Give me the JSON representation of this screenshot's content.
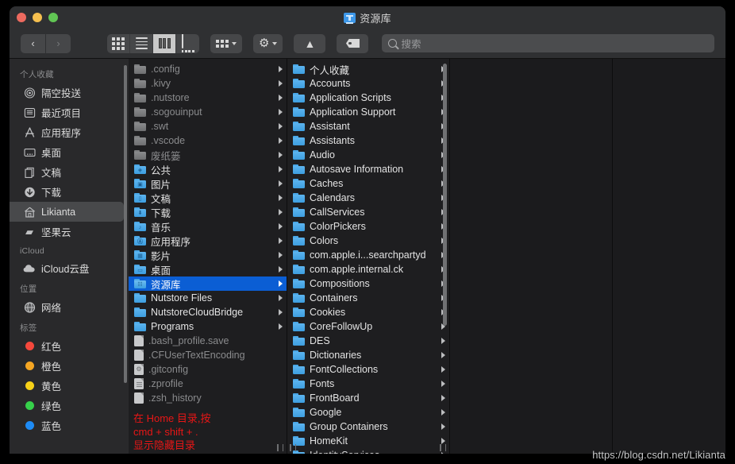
{
  "window": {
    "title": "资源库",
    "title_icon": "library-folder-icon",
    "traffic_lights": [
      {
        "name": "close",
        "color": "#ed6a5f"
      },
      {
        "name": "minimize",
        "color": "#f5bf4f"
      },
      {
        "name": "maximize",
        "color": "#61c554"
      }
    ]
  },
  "toolbar": {
    "back_label": "‹",
    "forward_label": "›",
    "view_modes": [
      {
        "name": "icon-view",
        "selected": false
      },
      {
        "name": "list-view",
        "selected": false
      },
      {
        "name": "column-view",
        "selected": true
      },
      {
        "name": "gallery-view",
        "selected": false
      }
    ],
    "group_button": "group-by-button",
    "action_button": "action-gear-button",
    "share_button": "share-button",
    "tags_button": "tags-button",
    "search": {
      "placeholder": "搜索",
      "value": ""
    }
  },
  "sidebar": {
    "sections": [
      {
        "header": "个人收藏",
        "items": [
          {
            "label": "隔空投送",
            "icon": "airdrop-icon",
            "selected": false
          },
          {
            "label": "最近项目",
            "icon": "recents-icon",
            "selected": false
          },
          {
            "label": "应用程序",
            "icon": "applications-icon",
            "selected": false
          },
          {
            "label": "桌面",
            "icon": "desktop-icon",
            "selected": false
          },
          {
            "label": "文稿",
            "icon": "documents-icon",
            "selected": false
          },
          {
            "label": "下载",
            "icon": "downloads-icon",
            "selected": false
          },
          {
            "label": "Likianta",
            "icon": "home-icon",
            "selected": true
          },
          {
            "label": "坚果云",
            "icon": "folder-icon",
            "selected": false
          }
        ]
      },
      {
        "header": "iCloud",
        "items": [
          {
            "label": "iCloud云盘",
            "icon": "icloud-icon",
            "selected": false
          }
        ]
      },
      {
        "header": "位置",
        "items": [
          {
            "label": "网络",
            "icon": "network-globe-icon",
            "selected": false
          }
        ]
      },
      {
        "header": "标签",
        "items": [
          {
            "label": "红色",
            "icon": "tag-dot-icon",
            "color": "#f5483c",
            "selected": false
          },
          {
            "label": "橙色",
            "icon": "tag-dot-icon",
            "color": "#f5a623",
            "selected": false
          },
          {
            "label": "黄色",
            "icon": "tag-dot-icon",
            "color": "#f7d118",
            "selected": false
          },
          {
            "label": "绿色",
            "icon": "tag-dot-icon",
            "color": "#36d04a",
            "selected": false
          },
          {
            "label": "蓝色",
            "icon": "tag-dot-icon",
            "color": "#1e8bf5",
            "selected": false
          }
        ]
      }
    ]
  },
  "columns": [
    {
      "name": "home-column",
      "items": [
        {
          "label": ".config",
          "icon": "folder-gray",
          "dim": true,
          "arrow": true,
          "selected": false
        },
        {
          "label": ".kivy",
          "icon": "folder-gray",
          "dim": true,
          "arrow": true,
          "selected": false
        },
        {
          "label": ".nutstore",
          "icon": "folder-gray",
          "dim": true,
          "arrow": true,
          "selected": false
        },
        {
          "label": ".sogouinput",
          "icon": "folder-gray",
          "dim": true,
          "arrow": true,
          "selected": false
        },
        {
          "label": ".swt",
          "icon": "folder-gray",
          "dim": true,
          "arrow": true,
          "selected": false
        },
        {
          "label": ".vscode",
          "icon": "folder-gray",
          "dim": true,
          "arrow": true,
          "selected": false
        },
        {
          "label": "废纸篓",
          "icon": "folder-gray",
          "dim": true,
          "arrow": true,
          "selected": false
        },
        {
          "label": "公共",
          "icon": "folder-public",
          "dim": false,
          "arrow": true,
          "selected": false
        },
        {
          "label": "图片",
          "icon": "folder-pictures",
          "dim": false,
          "arrow": true,
          "selected": false
        },
        {
          "label": "文稿",
          "icon": "folder-documents",
          "dim": false,
          "arrow": true,
          "selected": false
        },
        {
          "label": "下载",
          "icon": "folder-downloads",
          "dim": false,
          "arrow": true,
          "selected": false
        },
        {
          "label": "音乐",
          "icon": "folder-music",
          "dim": false,
          "arrow": true,
          "selected": false
        },
        {
          "label": "应用程序",
          "icon": "folder-applications",
          "dim": false,
          "arrow": true,
          "selected": false
        },
        {
          "label": "影片",
          "icon": "folder-movies",
          "dim": false,
          "arrow": true,
          "selected": false
        },
        {
          "label": "桌面",
          "icon": "folder-desktop",
          "dim": false,
          "arrow": true,
          "selected": false
        },
        {
          "label": "资源库",
          "icon": "folder-library",
          "dim": false,
          "arrow": true,
          "selected": true
        },
        {
          "label": "Nutstore Files",
          "icon": "folder-blue",
          "dim": false,
          "arrow": true,
          "selected": false
        },
        {
          "label": "NutstoreCloudBridge",
          "icon": "folder-blue",
          "dim": false,
          "arrow": true,
          "selected": false
        },
        {
          "label": "Programs",
          "icon": "folder-blue",
          "dim": false,
          "arrow": true,
          "selected": false
        },
        {
          "label": ".bash_profile.save",
          "icon": "doc-plain",
          "dim": true,
          "arrow": false,
          "selected": false
        },
        {
          "label": ".CFUserTextEncoding",
          "icon": "doc-plain",
          "dim": true,
          "arrow": false,
          "selected": false
        },
        {
          "label": ".gitconfig",
          "icon": "doc-cog",
          "dim": true,
          "arrow": false,
          "selected": false
        },
        {
          "label": ".zprofile",
          "icon": "doc-lines",
          "dim": true,
          "arrow": false,
          "selected": false
        },
        {
          "label": ".zsh_history",
          "icon": "doc-plain",
          "dim": true,
          "arrow": false,
          "selected": false
        }
      ]
    },
    {
      "name": "library-column",
      "items": [
        {
          "label": "个人收藏",
          "icon": "folder-blue",
          "arrow": true
        },
        {
          "label": "Accounts",
          "icon": "folder-blue",
          "arrow": true
        },
        {
          "label": "Application Scripts",
          "icon": "folder-blue",
          "arrow": true
        },
        {
          "label": "Application Support",
          "icon": "folder-blue",
          "arrow": true
        },
        {
          "label": "Assistant",
          "icon": "folder-blue",
          "arrow": true
        },
        {
          "label": "Assistants",
          "icon": "folder-blue",
          "arrow": true
        },
        {
          "label": "Audio",
          "icon": "folder-blue",
          "arrow": true
        },
        {
          "label": "Autosave Information",
          "icon": "folder-blue",
          "arrow": true
        },
        {
          "label": "Caches",
          "icon": "folder-blue",
          "arrow": true
        },
        {
          "label": "Calendars",
          "icon": "folder-blue",
          "arrow": true
        },
        {
          "label": "CallServices",
          "icon": "folder-blue",
          "arrow": true
        },
        {
          "label": "ColorPickers",
          "icon": "folder-blue",
          "arrow": true
        },
        {
          "label": "Colors",
          "icon": "folder-blue",
          "arrow": true
        },
        {
          "label": "com.apple.i...searchpartyd",
          "icon": "folder-blue",
          "arrow": true
        },
        {
          "label": "com.apple.internal.ck",
          "icon": "folder-blue",
          "arrow": true
        },
        {
          "label": "Compositions",
          "icon": "folder-blue",
          "arrow": true
        },
        {
          "label": "Containers",
          "icon": "folder-blue",
          "arrow": true
        },
        {
          "label": "Cookies",
          "icon": "folder-blue",
          "arrow": true
        },
        {
          "label": "CoreFollowUp",
          "icon": "folder-blue",
          "arrow": true
        },
        {
          "label": "DES",
          "icon": "folder-blue",
          "arrow": true
        },
        {
          "label": "Dictionaries",
          "icon": "folder-blue",
          "arrow": true
        },
        {
          "label": "FontCollections",
          "icon": "folder-blue",
          "arrow": true
        },
        {
          "label": "Fonts",
          "icon": "folder-blue",
          "arrow": true
        },
        {
          "label": "FrontBoard",
          "icon": "folder-blue",
          "arrow": true
        },
        {
          "label": "Google",
          "icon": "folder-blue",
          "arrow": true
        },
        {
          "label": "Group Containers",
          "icon": "folder-blue",
          "arrow": true
        },
        {
          "label": "HomeKit",
          "icon": "folder-blue",
          "arrow": true
        },
        {
          "label": "IdentityServices",
          "icon": "folder-blue",
          "arrow": true
        }
      ]
    },
    {
      "name": "preview-column-3",
      "items": []
    },
    {
      "name": "preview-column-4",
      "items": []
    }
  ],
  "annotation": {
    "text": "在 Home 目录,按\ncmd + shift + .\n显示隐藏目录",
    "color": "#e81616"
  },
  "watermark": "https://blog.csdn.net/Likianta"
}
